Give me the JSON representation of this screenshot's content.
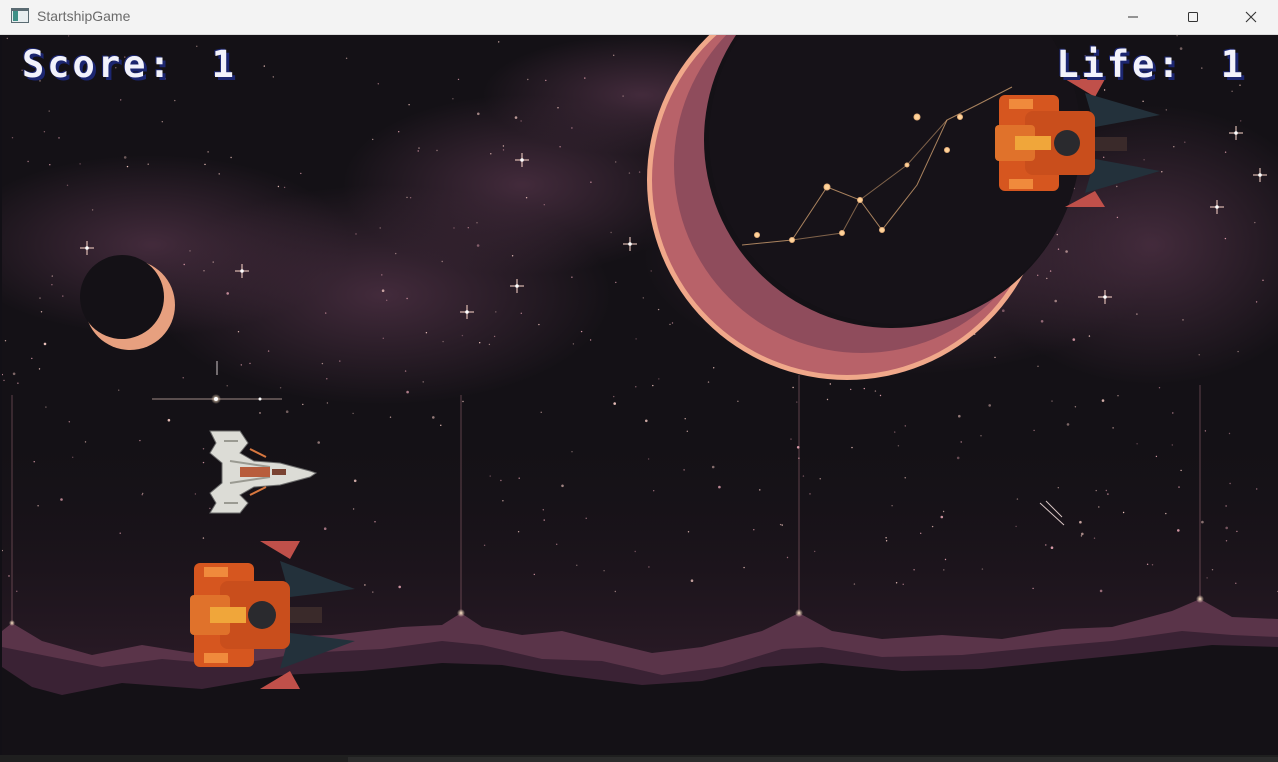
{
  "window": {
    "title": "StartshipGame"
  },
  "hud": {
    "score_label": "Score:",
    "score_value": "1",
    "life_label": "Life:",
    "life_value": "1"
  },
  "colors": {
    "background": "#141116",
    "nebula": "#4a2e41",
    "moon": "#c16a6e",
    "moon_rim": "#f0a88a",
    "ground": "#553347",
    "hud_text": "#f2f2fb",
    "hud_shadow": "#1c2670",
    "enemy": "#d6561f",
    "player": "#dcdcd6"
  },
  "icons": {
    "app": "app-window-icon",
    "minimize": "minimize-icon",
    "maximize": "maximize-icon",
    "close": "close-icon"
  }
}
